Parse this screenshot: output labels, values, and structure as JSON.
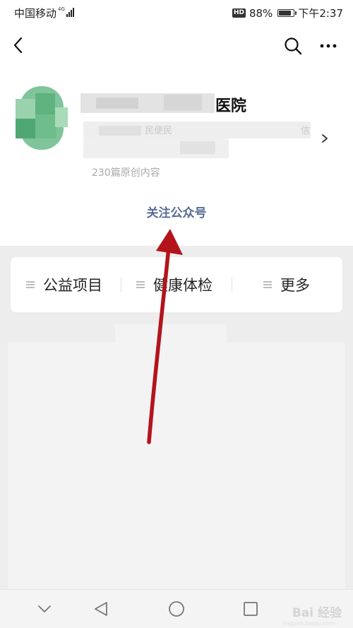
{
  "status_bar": {
    "carrier": "中国移动",
    "network": "4G",
    "battery": "88%",
    "battery_level": 0.88,
    "time": "下午2:37",
    "hd_badge": "HD"
  },
  "nav": {
    "back_icon": "back-chevron-icon",
    "search_icon": "search-icon",
    "more_icon": "more-dots-icon"
  },
  "profile": {
    "account_name_visible": "医院",
    "desc_fragment_1": "民便民",
    "desc_fragment_2": "信",
    "article_count": "230篇原创内容",
    "follow_label": "关注公众号",
    "chevron_icon": "chevron-right-icon"
  },
  "menu": {
    "items": [
      {
        "label": "公益项目",
        "icon": "menu-lines-icon"
      },
      {
        "label": "健康体检",
        "icon": "menu-lines-icon"
      },
      {
        "label": "更多",
        "icon": "menu-lines-icon"
      }
    ]
  },
  "system_nav": {
    "down_icon": "collapse-chevron-icon",
    "back_icon": "back-triangle-icon",
    "home_icon": "home-circle-icon",
    "recent_icon": "recent-square-icon"
  },
  "watermark": {
    "brand": "Bai 经验",
    "url": "jingyan.baidu.com"
  },
  "colors": {
    "link": "#576b95",
    "annotation_arrow": "#b3141c",
    "page_bg": "#ededed"
  }
}
